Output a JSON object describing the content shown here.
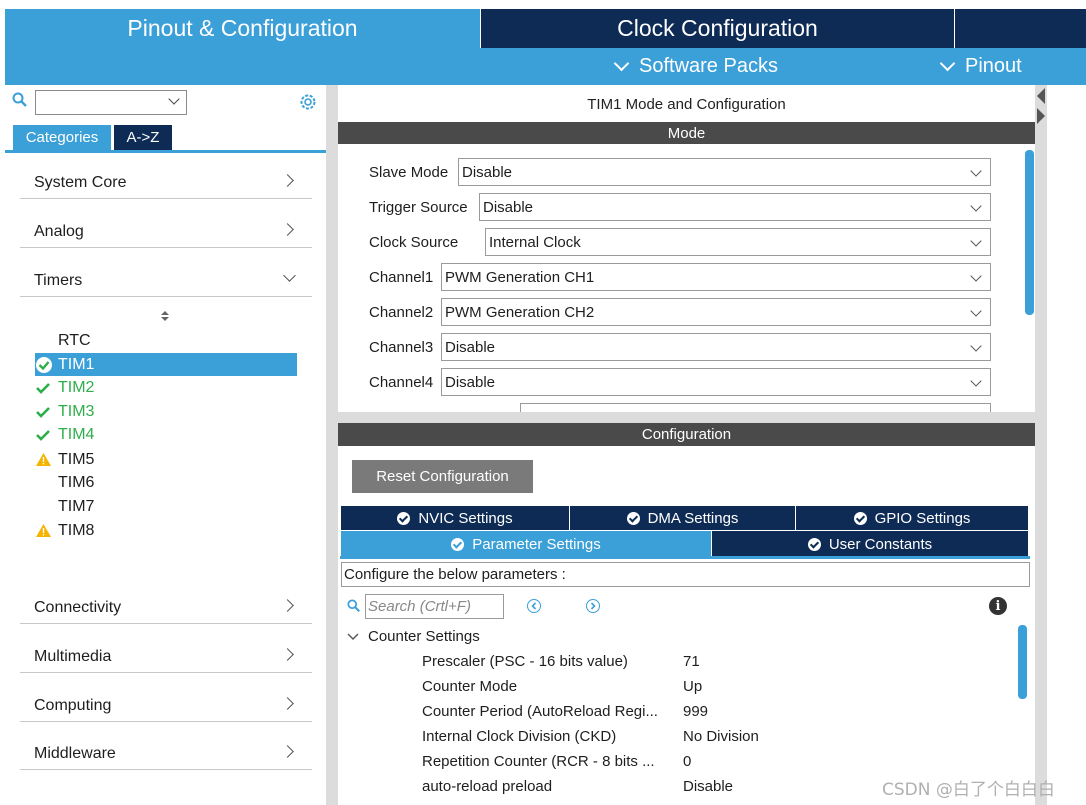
{
  "tabs": {
    "pinout": "Pinout & Configuration",
    "clock": "Clock Configuration"
  },
  "submenu": {
    "software_packs": "Software Packs",
    "pinout": "Pinout"
  },
  "left": {
    "categories_tab": "Categories",
    "az_tab": "A->Z",
    "categories": [
      "System Core",
      "Analog",
      "Timers",
      "Connectivity",
      "Multimedia",
      "Computing",
      "Middleware"
    ],
    "timers": [
      {
        "name": "RTC",
        "status": "none"
      },
      {
        "name": "TIM1",
        "status": "ok-selected"
      },
      {
        "name": "TIM2",
        "status": "ok"
      },
      {
        "name": "TIM3",
        "status": "ok"
      },
      {
        "name": "TIM4",
        "status": "ok"
      },
      {
        "name": "TIM5",
        "status": "warning"
      },
      {
        "name": "TIM6",
        "status": "none"
      },
      {
        "name": "TIM7",
        "status": "none"
      },
      {
        "name": "TIM8",
        "status": "warning"
      }
    ]
  },
  "mode": {
    "title": "TIM1 Mode and Configuration",
    "section": "Mode",
    "fields": [
      {
        "label": "Slave Mode",
        "value": "Disable"
      },
      {
        "label": "Trigger Source",
        "value": "Disable"
      },
      {
        "label": "Clock Source",
        "value": "Internal Clock"
      },
      {
        "label": "Channel1",
        "value": "PWM Generation CH1"
      },
      {
        "label": "Channel2",
        "value": "PWM Generation CH2"
      },
      {
        "label": "Channel3",
        "value": "Disable"
      },
      {
        "label": "Channel4",
        "value": "Disable"
      }
    ]
  },
  "config": {
    "section": "Configuration",
    "reset_label": "Reset Configuration",
    "tabs_row1": [
      "NVIC Settings",
      "DMA Settings",
      "GPIO Settings"
    ],
    "tabs_row2": [
      "Parameter Settings",
      "User Constants"
    ],
    "hint": "Configure the below parameters :",
    "search_placeholder": "Search (Crtl+F)",
    "group": "Counter Settings",
    "params": [
      {
        "name": "Prescaler (PSC - 16 bits value)",
        "value": "71"
      },
      {
        "name": "Counter Mode",
        "value": "Up"
      },
      {
        "name": "Counter Period (AutoReload Regi...",
        "value": "999"
      },
      {
        "name": "Internal Clock Division (CKD)",
        "value": "No Division"
      },
      {
        "name": "Repetition Counter (RCR - 8 bits ...",
        "value": "0"
      },
      {
        "name": "auto-reload preload",
        "value": "Disable"
      }
    ]
  },
  "watermark": "CSDN @白了个白白白",
  "colors": {
    "accent": "#3b9fd8",
    "navy": "#0d2b55",
    "ok": "#2fae4a",
    "warn": "#f5b400"
  }
}
